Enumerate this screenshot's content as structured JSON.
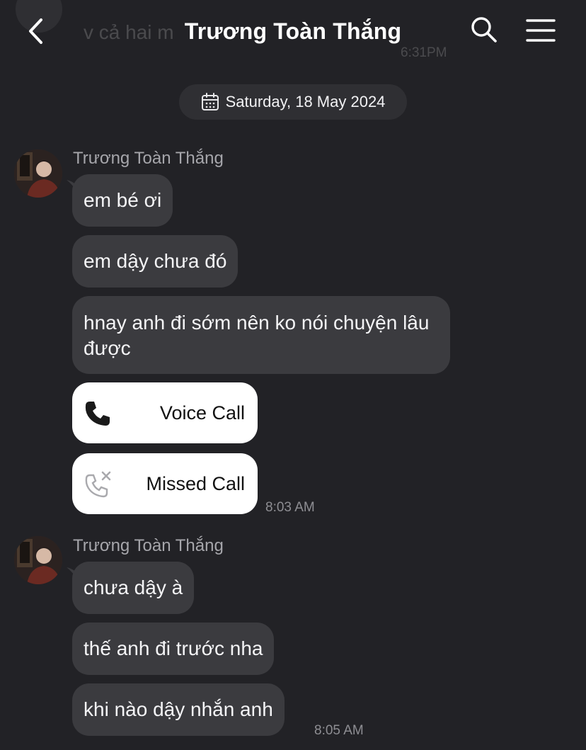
{
  "header": {
    "title": "Trương Toàn Thắng",
    "ghost_preview_text": "v cả hai m",
    "ghost_preview_time": "6:31PM"
  },
  "date_chip": {
    "label": "Saturday, 18 May 2024"
  },
  "groups": [
    {
      "sender": "Trương Toàn Thắng",
      "messages": [
        {
          "text": "em bé ơi"
        },
        {
          "text": "em dậy chưa đó"
        },
        {
          "text": "hnay anh đi sớm nên ko nói chuyện lâu được"
        }
      ],
      "calls": [
        {
          "label": "Voice Call",
          "icon": "phone-icon"
        },
        {
          "label": "Missed Call",
          "icon": "missed-call-icon"
        }
      ],
      "time": "8:03 AM"
    },
    {
      "sender": "Trương Toàn Thắng",
      "messages": [
        {
          "text": "chưa dậy à"
        },
        {
          "text": "thế anh đi trước nha"
        },
        {
          "text": "khi nào dậy nhắn anh"
        }
      ],
      "time": "8:05 AM"
    }
  ],
  "colors": {
    "background": "#222226",
    "bubble": "#3b3b3f",
    "call_card": "#ffffff",
    "muted_text": "#8e8e93"
  }
}
